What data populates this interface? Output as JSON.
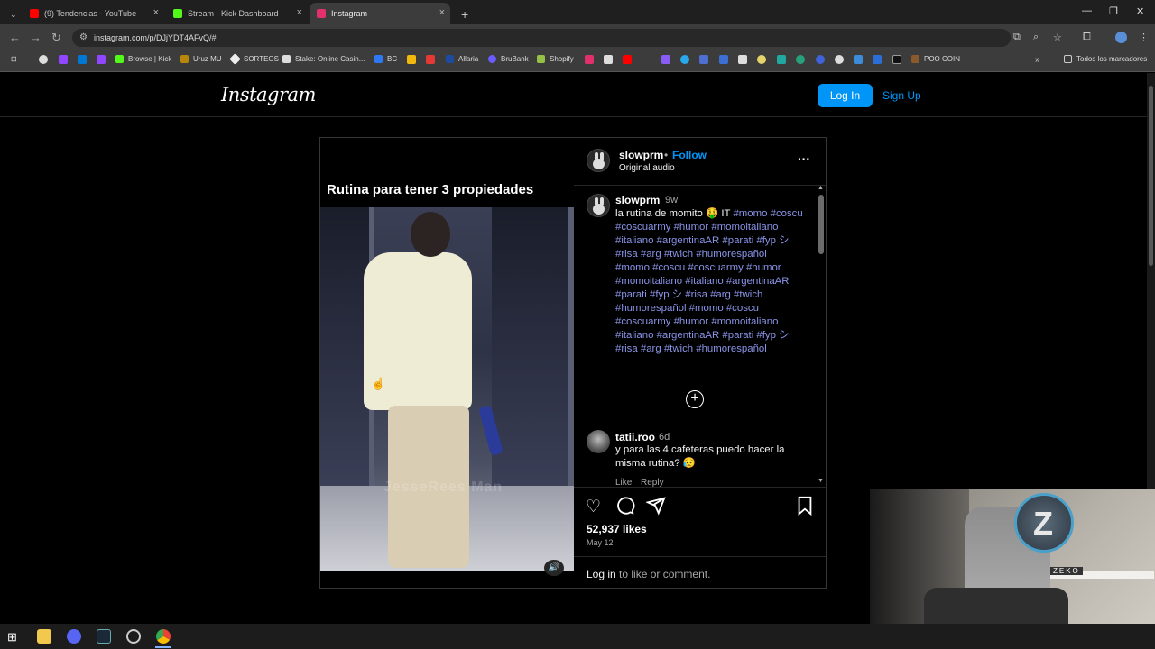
{
  "browser": {
    "tabs": [
      {
        "title": "(9) Tendencias - YouTube",
        "active": false,
        "color": "#ff0000"
      },
      {
        "title": "Stream - Kick Dashboard",
        "active": false,
        "color": "#53fc18"
      },
      {
        "title": "Instagram",
        "active": true,
        "color": "#e1306c"
      }
    ],
    "new_tab": "+",
    "url": "instagram.com/p/DJjYDT4AFvQ/#",
    "bookmarks": [
      "Browse | Kick",
      "Uruz MU",
      "SORTEOS",
      "Stake: Online Casin...",
      "BC",
      "Allaria",
      "BruBank",
      "Shopify",
      "POO COIN"
    ],
    "bookmarks_folder": "Todos los marcadores"
  },
  "instagram": {
    "logo": "Instagram",
    "login_label": "Log In",
    "signup_label": "Sign Up",
    "post": {
      "media_title": "Rutina para tener 3 propiedades",
      "watermark": "JesseRees Man",
      "username": "slowprm",
      "separator": "•",
      "follow_label": "Follow",
      "audio": "Original audio",
      "more": "···",
      "caption_user": "slowprm",
      "caption_time": "9w",
      "caption_lead": "la rutina de momito 🤑 IT ",
      "caption_tags": "#momo #coscu #coscuarmy #humor #momoitaliano #italiano #argentinaAR #parati #fyp シ #risa #arg #twich #humorespañol  #momo #coscu #coscuarmy #humor #momoitaliano #italiano #argentinaAR #parati #fyp シ #risa #arg #twich #humorespañol #momo #coscu #coscuarmy #humor #momoitaliano #italiano #argentinaAR #parati #fyp シ #risa #arg #twich #humorespañol",
      "comment": {
        "user": "tatii.roo",
        "time": "6d",
        "text": "y para las 4 cafeteras puedo hacer la misma rutina? 😥",
        "like": "Like",
        "reply": "Reply"
      },
      "likes": "52,937 likes",
      "date": "May 12",
      "login_link": "Log in",
      "login_rest": " to like or comment."
    }
  },
  "webcam": {
    "badge": "ZEKO"
  },
  "icons": {
    "heart": "heart-icon",
    "comment": "comment-icon",
    "share": "share-icon",
    "save": "bookmark-icon"
  }
}
